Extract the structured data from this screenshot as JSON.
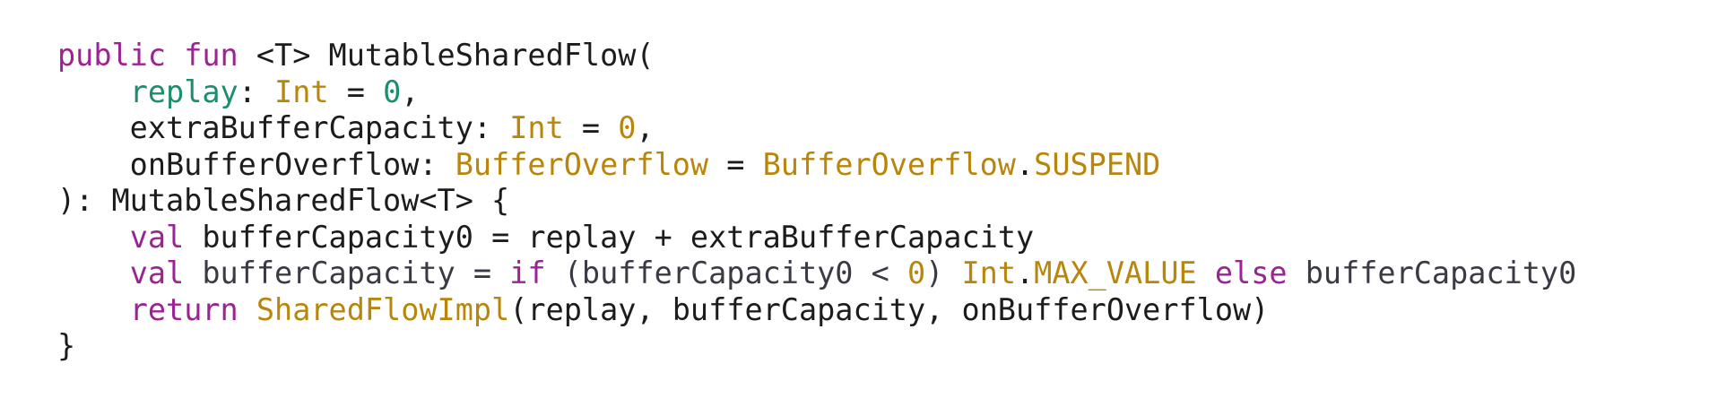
{
  "code": {
    "lines": [
      [
        {
          "t": "public",
          "c": "kw"
        },
        {
          "t": " ",
          "c": "plain"
        },
        {
          "t": "fun",
          "c": "kw"
        },
        {
          "t": " <T> MutableSharedFlow(",
          "c": "plain"
        }
      ],
      [
        {
          "t": "    ",
          "c": "plain"
        },
        {
          "t": "replay",
          "c": "param"
        },
        {
          "t": ": ",
          "c": "plain"
        },
        {
          "t": "Int",
          "c": "type"
        },
        {
          "t": " = ",
          "c": "plain"
        },
        {
          "t": "0",
          "c": "param"
        },
        {
          "t": ",",
          "c": "plain"
        }
      ],
      [
        {
          "t": "    extraBufferCapacity: ",
          "c": "plain"
        },
        {
          "t": "Int",
          "c": "type"
        },
        {
          "t": " = ",
          "c": "plain"
        },
        {
          "t": "0",
          "c": "num"
        },
        {
          "t": ",",
          "c": "plain"
        }
      ],
      [
        {
          "t": "    onBufferOverflow: ",
          "c": "plain"
        },
        {
          "t": "BufferOverflow",
          "c": "type"
        },
        {
          "t": " = ",
          "c": "plain"
        },
        {
          "t": "BufferOverflow",
          "c": "type"
        },
        {
          "t": ".",
          "c": "plain"
        },
        {
          "t": "SUSPEND",
          "c": "type"
        }
      ],
      [
        {
          "t": "): MutableSharedFlow<T> {",
          "c": "plain"
        }
      ],
      [
        {
          "t": "    ",
          "c": "plain"
        },
        {
          "t": "val",
          "c": "kw"
        },
        {
          "t": " bufferCapacity0 = replay + extraBufferCapacity",
          "c": "plain"
        }
      ],
      [
        {
          "t": "    ",
          "c": "plain"
        },
        {
          "t": "val",
          "c": "kw"
        },
        {
          "t": " bufferCapacity = ",
          "c": "muted"
        },
        {
          "t": "if",
          "c": "kw"
        },
        {
          "t": " (bufferCapacity0 < ",
          "c": "muted"
        },
        {
          "t": "0",
          "c": "num"
        },
        {
          "t": ") ",
          "c": "muted"
        },
        {
          "t": "Int",
          "c": "type"
        },
        {
          "t": ".",
          "c": "plain"
        },
        {
          "t": "MAX_VALUE",
          "c": "type"
        },
        {
          "t": " ",
          "c": "plain"
        },
        {
          "t": "else",
          "c": "kw"
        },
        {
          "t": " bufferCapacity0",
          "c": "muted"
        }
      ],
      [
        {
          "t": "    ",
          "c": "plain"
        },
        {
          "t": "return",
          "c": "kw"
        },
        {
          "t": " ",
          "c": "plain"
        },
        {
          "t": "SharedFlowImpl",
          "c": "type"
        },
        {
          "t": "(replay, bufferCapacity, onBufferOverflow)",
          "c": "plain"
        }
      ],
      [
        {
          "t": "}",
          "c": "plain"
        }
      ]
    ]
  }
}
